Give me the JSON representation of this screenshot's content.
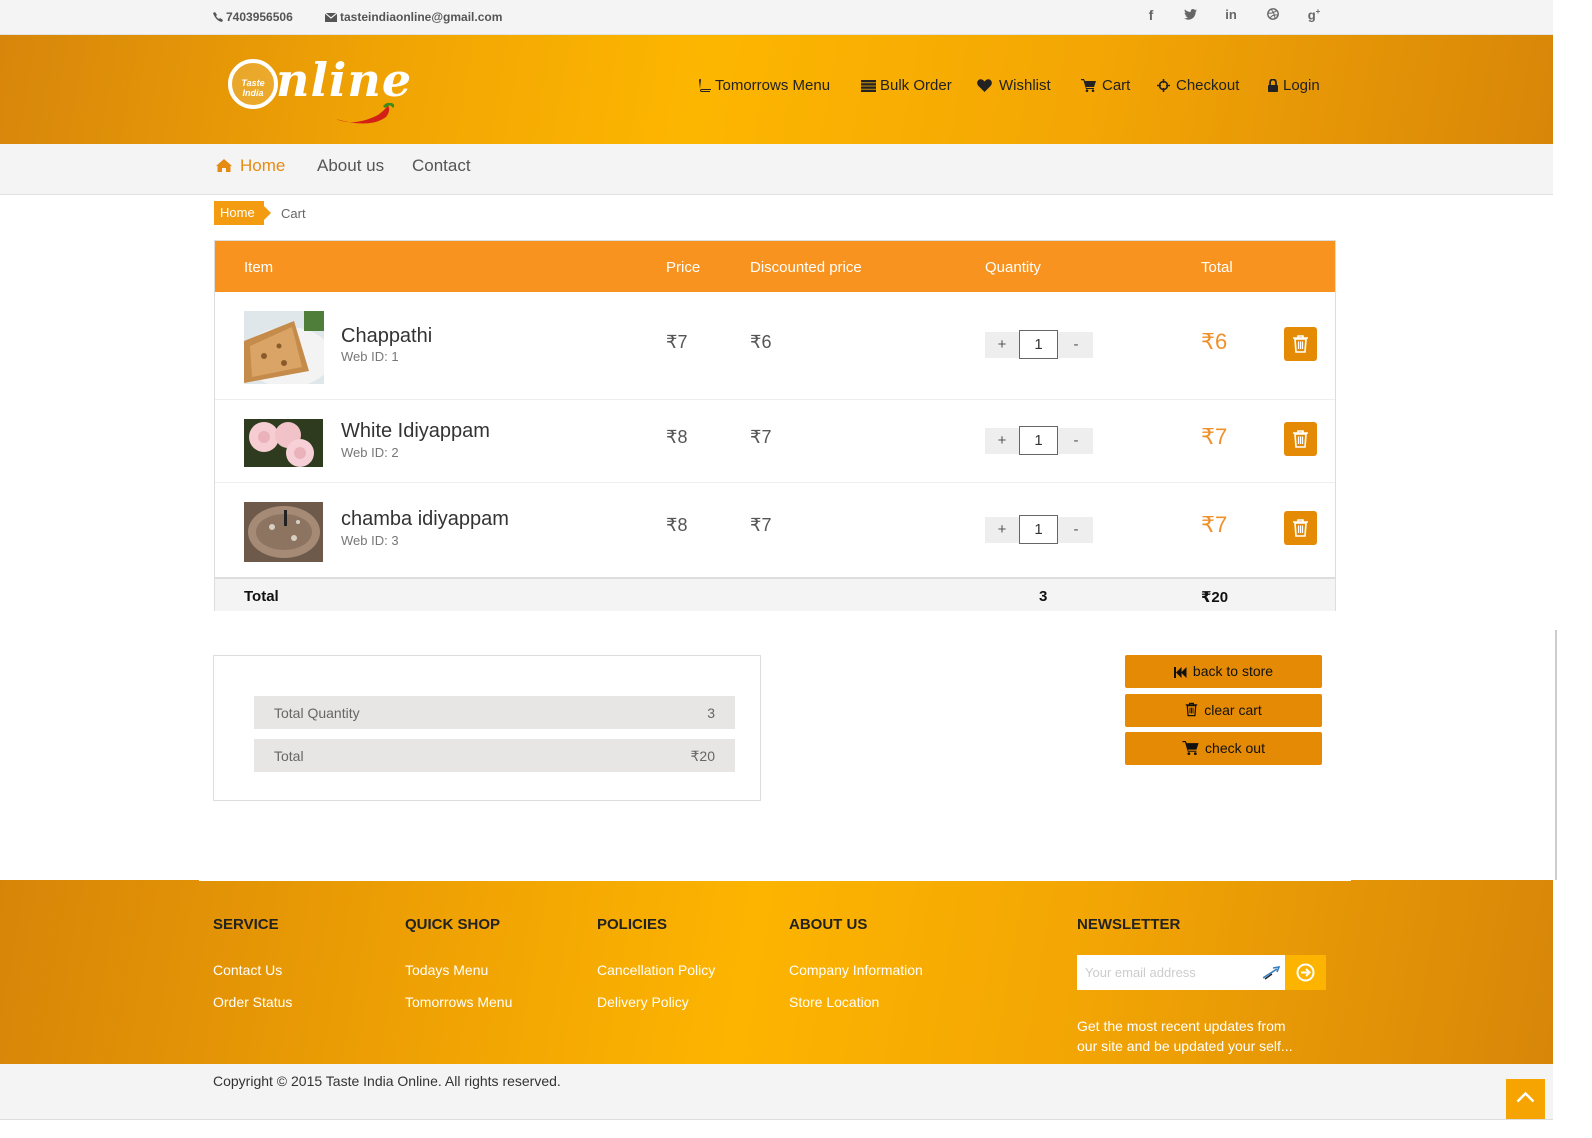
{
  "topbar": {
    "phone": "7403956506",
    "email": "tasteindiaonline@gmail.com",
    "social": [
      "f",
      "t",
      "in",
      "dribbble",
      "g+"
    ]
  },
  "logo": {
    "badge": "Taste India",
    "text": "nline"
  },
  "mainnav": {
    "tomorrows_menu": "Tomorrows Menu",
    "bulk_order": "Bulk Order",
    "wishlist": "Wishlist",
    "cart": "Cart",
    "checkout": "Checkout",
    "login": "Login"
  },
  "subnav": {
    "home": "Home",
    "about": "About us",
    "contact": "Contact"
  },
  "breadcrumb": {
    "home": "Home",
    "current": "Cart"
  },
  "cart": {
    "headers": {
      "item": "Item",
      "price": "Price",
      "discounted": "Discounted price",
      "quantity": "Quantity",
      "total": "Total"
    },
    "items": [
      {
        "name": "Chappathi",
        "web_id": "Web ID: 1",
        "price": "₹7",
        "discounted": "₹6",
        "qty": "1",
        "total": "₹6"
      },
      {
        "name": "White Idiyappam",
        "web_id": "Web ID: 2",
        "price": "₹8",
        "discounted": "₹7",
        "qty": "1",
        "total": "₹7"
      },
      {
        "name": "chamba idiyappam",
        "web_id": "Web ID: 3",
        "price": "₹8",
        "discounted": "₹7",
        "qty": "1",
        "total": "₹7"
      }
    ],
    "footer": {
      "label": "Total",
      "qty": "3",
      "total": "₹20"
    },
    "plus": "+",
    "minus": "-"
  },
  "summary": {
    "total_quantity_label": "Total Quantity",
    "total_quantity_value": "3",
    "total_label": "Total",
    "total_value": "₹20"
  },
  "actions": {
    "back": "back to store",
    "clear": "clear cart",
    "checkout": "check out"
  },
  "footer": {
    "service": {
      "title": "SERVICE",
      "links": [
        "Contact Us",
        "Order Status"
      ]
    },
    "quick_shop": {
      "title": "QUICK SHOP",
      "links": [
        "Todays Menu",
        "Tomorrows Menu"
      ]
    },
    "policies": {
      "title": "POLICIES",
      "links": [
        "Cancellation Policy",
        "Delivery Policy"
      ]
    },
    "about": {
      "title": "ABOUT US",
      "links": [
        "Company Information",
        "Store Location"
      ]
    },
    "newsletter": {
      "title": "NEWSLETTER",
      "placeholder": "Your email address",
      "text": "Get the most recent updates from our site and be updated your self..."
    },
    "copyright": "Copyright © 2015 Taste India Online. All rights reserved."
  },
  "colors": {
    "accent": "#f7931e",
    "button": "#e48a04",
    "total_text": "#f0902a"
  }
}
